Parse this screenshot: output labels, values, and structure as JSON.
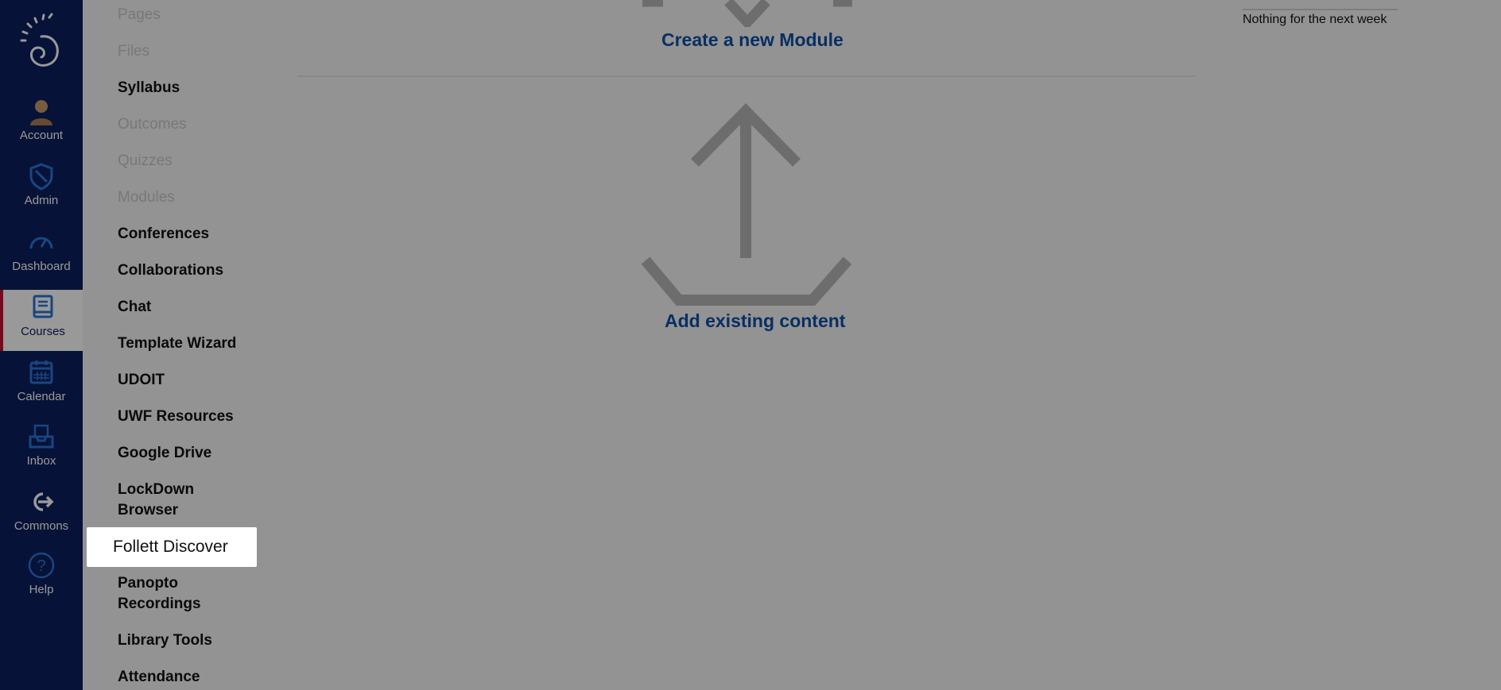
{
  "global_nav": {
    "items": [
      {
        "label": "Account",
        "icon": "user-avatar-icon"
      },
      {
        "label": "Admin",
        "icon": "admin-shield-icon"
      },
      {
        "label": "Dashboard",
        "icon": "dashboard-gauge-icon"
      },
      {
        "label": "Courses",
        "icon": "courses-book-icon",
        "active": true
      },
      {
        "label": "Calendar",
        "icon": "calendar-icon"
      },
      {
        "label": "Inbox",
        "icon": "inbox-icon"
      },
      {
        "label": "Commons",
        "icon": "commons-arrow-icon"
      },
      {
        "label": "Help",
        "icon": "help-question-icon"
      }
    ]
  },
  "course_nav": {
    "items": [
      {
        "label": "Pages",
        "enabled": false
      },
      {
        "label": "Files",
        "enabled": false
      },
      {
        "label": "Syllabus",
        "enabled": true
      },
      {
        "label": "Outcomes",
        "enabled": false
      },
      {
        "label": "Quizzes",
        "enabled": false
      },
      {
        "label": "Modules",
        "enabled": false
      },
      {
        "label": "Conferences",
        "enabled": true
      },
      {
        "label": "Collaborations",
        "enabled": true
      },
      {
        "label": "Chat",
        "enabled": true
      },
      {
        "label": "Template Wizard",
        "enabled": true
      },
      {
        "label": "UDOIT",
        "enabled": true
      },
      {
        "label": "UWF Resources",
        "enabled": true
      },
      {
        "label": "Google Drive",
        "enabled": true
      },
      {
        "label": "LockDown Browser",
        "enabled": true
      },
      {
        "label": "Follett Discover",
        "enabled": true,
        "highlighted": true
      },
      {
        "label": "Panopto Recordings",
        "enabled": true
      },
      {
        "label": "Library Tools",
        "enabled": true
      },
      {
        "label": "Attendance",
        "enabled": true
      }
    ]
  },
  "main": {
    "create_module_label": "Create a new Module",
    "add_content_label": "Add existing content"
  },
  "right_sidebar": {
    "upcoming_text": "Nothing for the next week"
  },
  "colors": {
    "nav_bg": "#0b1f5c",
    "link_blue": "#0e4fa6",
    "active_accent": "#c8102e"
  }
}
